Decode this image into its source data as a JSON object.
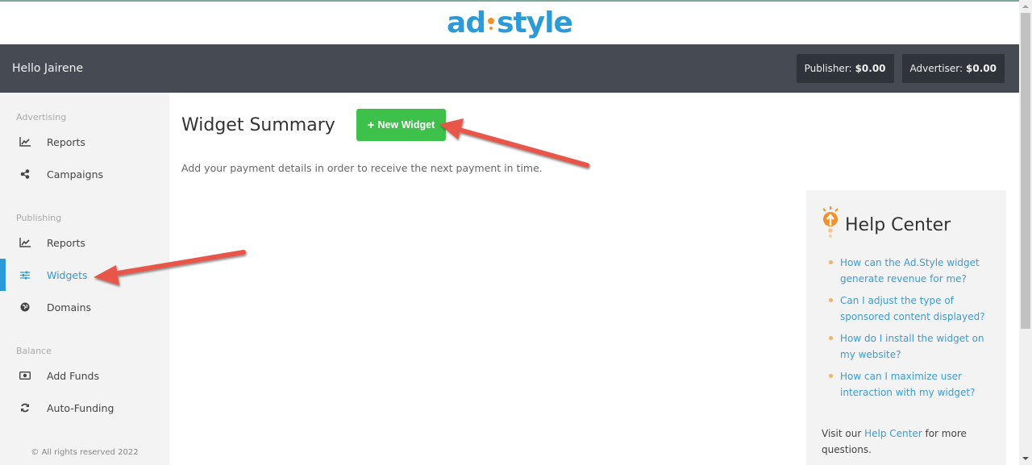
{
  "brand": {
    "logo_left": "ad",
    "logo_right": "style",
    "accent": "#2d9ad8",
    "bulb_color": "#f0922b"
  },
  "header": {
    "greeting": "Hello Jairene",
    "publisher_label": "Publisher:",
    "publisher_value": "$0.00",
    "advertiser_label": "Advertiser:",
    "advertiser_value": "$0.00"
  },
  "sidebar": {
    "sections": [
      {
        "title": "Advertising",
        "items": [
          {
            "label": "Reports",
            "icon": "chart-line-icon"
          },
          {
            "label": "Campaigns",
            "icon": "share-icon"
          }
        ]
      },
      {
        "title": "Publishing",
        "items": [
          {
            "label": "Reports",
            "icon": "chart-line-icon"
          },
          {
            "label": "Widgets",
            "icon": "sliders-icon",
            "active": true
          },
          {
            "label": "Domains",
            "icon": "globe-icon"
          }
        ]
      },
      {
        "title": "Balance",
        "items": [
          {
            "label": "Add Funds",
            "icon": "money-icon"
          },
          {
            "label": "Auto-Funding",
            "icon": "refresh-icon"
          }
        ]
      }
    ],
    "copyright": "© All rights reserved 2022"
  },
  "main": {
    "title": "Widget Summary",
    "new_widget_label": "New Widget",
    "notice": "Add your payment details in order to receive the next payment in time."
  },
  "help_center": {
    "title": "Help Center",
    "questions": [
      "How can the Ad.Style widget generate revenue for me?",
      "Can I adjust the type of sponsored content displayed?",
      "How do I install the widget on my website?",
      "How can I maximize user interaction with my widget?"
    ],
    "footer_prefix": "Visit our",
    "footer_link": "Help Center",
    "footer_suffix": "for more questions."
  },
  "annotations": {
    "arrow_color": "#e8564a"
  }
}
